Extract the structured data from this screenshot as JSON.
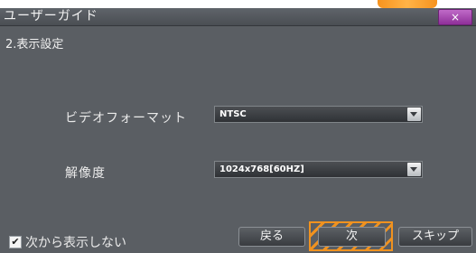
{
  "dialog": {
    "title": "ユーザーガイド",
    "close_label": "×"
  },
  "section": {
    "title": "2.表示設定"
  },
  "fields": {
    "video_format": {
      "label": "ビデオフォーマット",
      "value": "NTSC"
    },
    "resolution": {
      "label": "解像度",
      "value": "1024x768[60HZ]"
    }
  },
  "footer": {
    "checkbox_label": "次から表示しない",
    "checkbox_checked": true,
    "checkbox_mark": "✔",
    "back_label": "戻る",
    "next_label": "次",
    "skip_label": "スキップ"
  },
  "colors": {
    "dialog_background": "#5a5e63",
    "focus_highlight": "#f0921f",
    "close_button": "#a244ad"
  }
}
